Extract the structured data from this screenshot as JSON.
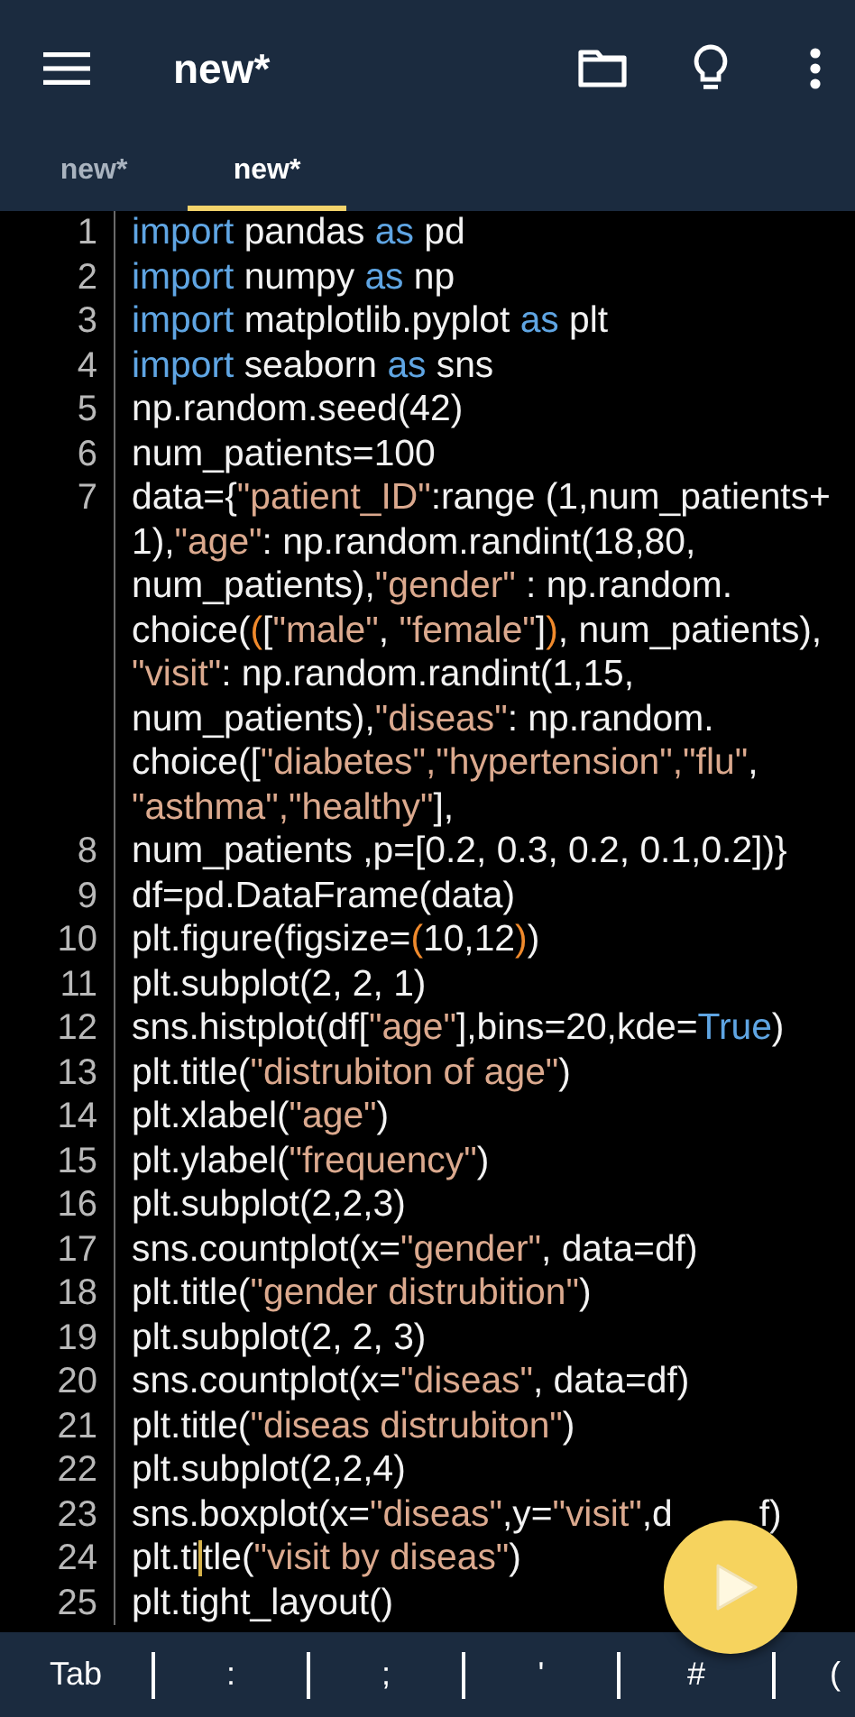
{
  "app_bar": {
    "title": "new*"
  },
  "tabs": [
    {
      "label": "new*",
      "selected": false
    },
    {
      "label": "new*",
      "selected": true
    }
  ],
  "code_lines": [
    {
      "number": "1",
      "wraps": [
        {
          "tokens": [
            {
              "kind": "keyword",
              "text": "import"
            },
            {
              "text": " pandas "
            },
            {
              "kind": "keyword",
              "text": "as"
            },
            {
              "text": " pd"
            }
          ]
        }
      ]
    },
    {
      "number": "2",
      "wraps": [
        {
          "tokens": [
            {
              "kind": "keyword",
              "text": "import"
            },
            {
              "text": " numpy "
            },
            {
              "kind": "keyword",
              "text": "as"
            },
            {
              "text": " np"
            }
          ]
        }
      ]
    },
    {
      "number": "3",
      "wraps": [
        {
          "tokens": [
            {
              "kind": "keyword",
              "text": "import"
            },
            {
              "text": " matplotlib.pyplot "
            },
            {
              "kind": "keyword",
              "text": "as"
            },
            {
              "text": " plt"
            }
          ]
        }
      ]
    },
    {
      "number": "4",
      "wraps": [
        {
          "tokens": [
            {
              "kind": "keyword",
              "text": "import"
            },
            {
              "text": " seaborn "
            },
            {
              "kind": "keyword",
              "text": "as"
            },
            {
              "text": " sns"
            }
          ]
        }
      ]
    },
    {
      "number": "5",
      "wraps": [
        {
          "tokens": [
            {
              "text": "np.random.seed(42)"
            }
          ]
        }
      ]
    },
    {
      "number": "6",
      "wraps": [
        {
          "tokens": [
            {
              "text": "num_patients=100"
            }
          ]
        }
      ]
    },
    {
      "number": "7",
      "wraps": [
        {
          "tokens": [
            {
              "text": "data={"
            },
            {
              "kind": "string",
              "text": "\"patient_ID\""
            },
            {
              "text": ":range (1,num_patients+"
            }
          ]
        },
        {
          "tokens": [
            {
              "text": "1),"
            },
            {
              "kind": "string",
              "text": "\"age\""
            },
            {
              "text": ": np.random.randint(18,80,"
            }
          ]
        },
        {
          "tokens": [
            {
              "text": "num_patients),"
            },
            {
              "kind": "string",
              "text": "\"gender\""
            },
            {
              "text": " : np.random."
            }
          ]
        },
        {
          "tokens": [
            {
              "text": "choice("
            },
            {
              "kind": "bracket",
              "text": "("
            },
            {
              "text": "["
            },
            {
              "kind": "string",
              "text": "\"male\""
            },
            {
              "text": ", "
            },
            {
              "kind": "string",
              "text": "\"female\""
            },
            {
              "text": "]"
            },
            {
              "kind": "bracket",
              "text": ")"
            },
            {
              "text": ", num_patients),"
            }
          ]
        },
        {
          "tokens": [
            {
              "kind": "string",
              "text": "\"visit\""
            },
            {
              "text": ": np.random.randint(1,15,"
            }
          ]
        },
        {
          "tokens": [
            {
              "text": "num_patients),"
            },
            {
              "kind": "string",
              "text": "\"diseas\""
            },
            {
              "text": ": np.random."
            }
          ]
        },
        {
          "tokens": [
            {
              "text": "choice(["
            },
            {
              "kind": "string",
              "text": "\"diabetes\","
            },
            {
              "kind": "string",
              "text": "\"hypertension\","
            },
            {
              "kind": "string",
              "text": "\"flu\""
            },
            {
              "text": ","
            }
          ]
        },
        {
          "tokens": [
            {
              "kind": "string",
              "text": "\"asthma\","
            },
            {
              "kind": "string",
              "text": "\"healthy\""
            },
            {
              "text": "],"
            }
          ]
        }
      ]
    },
    {
      "number": "8",
      "wraps": [
        {
          "tokens": [
            {
              "text": "num_patients ,p=[0.2, 0.3, 0.2, 0.1,0.2])}"
            }
          ]
        }
      ]
    },
    {
      "number": "9",
      "wraps": [
        {
          "tokens": [
            {
              "text": "df=pd.DataFrame(data)"
            }
          ]
        }
      ]
    },
    {
      "number": "10",
      "wraps": [
        {
          "tokens": [
            {
              "text": "plt.figure(figsize="
            },
            {
              "kind": "bracket",
              "text": "("
            },
            {
              "text": "10,12"
            },
            {
              "kind": "bracket",
              "text": ")"
            },
            {
              "text": ")"
            }
          ]
        }
      ]
    },
    {
      "number": "11",
      "wraps": [
        {
          "tokens": [
            {
              "text": "plt.subplot(2, 2, 1)"
            }
          ]
        }
      ]
    },
    {
      "number": "12",
      "wraps": [
        {
          "tokens": [
            {
              "text": "sns.histplot(df["
            },
            {
              "kind": "string",
              "text": "\"age\""
            },
            {
              "text": "],bins=20,kde="
            },
            {
              "kind": "keyword",
              "text": "True"
            },
            {
              "text": ")"
            }
          ]
        }
      ]
    },
    {
      "number": "13",
      "wraps": [
        {
          "tokens": [
            {
              "text": "plt.title("
            },
            {
              "kind": "string",
              "text": "\"distrubiton of age\""
            },
            {
              "text": ")"
            }
          ]
        }
      ]
    },
    {
      "number": "14",
      "wraps": [
        {
          "tokens": [
            {
              "text": "plt.xlabel("
            },
            {
              "kind": "string",
              "text": "\"age\""
            },
            {
              "text": ")"
            }
          ]
        }
      ]
    },
    {
      "number": "15",
      "wraps": [
        {
          "tokens": [
            {
              "text": "plt.ylabel("
            },
            {
              "kind": "string",
              "text": "\"frequency\""
            },
            {
              "text": ")"
            }
          ]
        }
      ]
    },
    {
      "number": "16",
      "wraps": [
        {
          "tokens": [
            {
              "text": "plt.subplot(2,2,3)"
            }
          ]
        }
      ]
    },
    {
      "number": "17",
      "wraps": [
        {
          "tokens": [
            {
              "text": "sns.countplot(x="
            },
            {
              "kind": "string",
              "text": "\"gender\""
            },
            {
              "text": ", data=df)"
            }
          ]
        }
      ]
    },
    {
      "number": "18",
      "wraps": [
        {
          "tokens": [
            {
              "text": "plt.title("
            },
            {
              "kind": "string",
              "text": "\"gender distrubition\""
            },
            {
              "text": ")"
            }
          ]
        }
      ]
    },
    {
      "number": "19",
      "wraps": [
        {
          "tokens": [
            {
              "text": "plt.subplot(2, 2, 3)"
            }
          ]
        }
      ]
    },
    {
      "number": "20",
      "wraps": [
        {
          "tokens": [
            {
              "text": "sns.countplot(x="
            },
            {
              "kind": "string",
              "text": "\"diseas\""
            },
            {
              "text": ", data=df)"
            }
          ]
        }
      ]
    },
    {
      "number": "21",
      "wraps": [
        {
          "tokens": [
            {
              "text": "plt.title("
            },
            {
              "kind": "string",
              "text": "\"diseas distrubiton\""
            },
            {
              "text": ")"
            }
          ]
        }
      ]
    },
    {
      "number": "22",
      "wraps": [
        {
          "tokens": [
            {
              "text": "plt.subplot(2,2,4)"
            }
          ]
        }
      ]
    },
    {
      "number": "23",
      "wraps": [
        {
          "tokens": [
            {
              "text": "sns.boxplot(x="
            },
            {
              "kind": "string",
              "text": "\"diseas\""
            },
            {
              "text": ",y="
            },
            {
              "kind": "string",
              "text": "\"visit\""
            },
            {
              "text": ",d"
            },
            {
              "kind": "covered"
            },
            {
              "text": "f)"
            }
          ]
        }
      ]
    },
    {
      "number": "24",
      "wraps": [
        {
          "tokens": [
            {
              "text": "plt.ti"
            },
            {
              "kind": "cursor"
            },
            {
              "text": "tle("
            },
            {
              "kind": "string",
              "text": "\"visit by diseas\""
            },
            {
              "text": ")"
            }
          ]
        }
      ]
    },
    {
      "number": "25",
      "wraps": [
        {
          "tokens": [
            {
              "text": "plt.tight_layout()"
            }
          ]
        }
      ]
    }
  ],
  "key_bar": [
    "Tab",
    ":",
    ";",
    "'",
    "#",
    "("
  ]
}
